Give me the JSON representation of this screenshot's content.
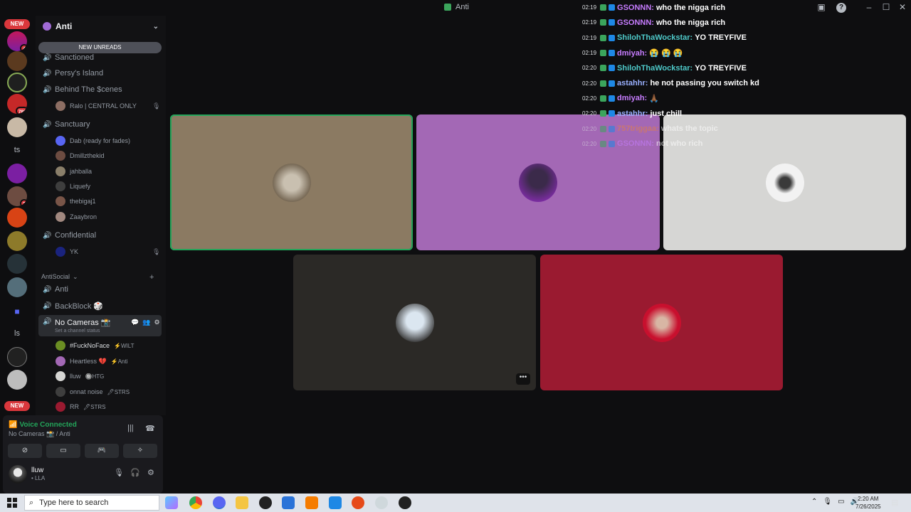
{
  "window": {
    "title": "Anti"
  },
  "rail": {
    "new_top": "NEW",
    "new_bottom": "NEW",
    "badge_1": "4",
    "badge_2": "786",
    "badge_3": "2",
    "text_ts": "ts",
    "text_ls": "ls"
  },
  "sidebar": {
    "server_name": "Anti",
    "new_unreads": "NEW UNREADS",
    "channels": [
      {
        "name": "Sanctioned"
      },
      {
        "name": "Persy's Island"
      },
      {
        "name": "Behind The $cenes"
      },
      {
        "name": "Sanctuary"
      },
      {
        "name": "Confidential"
      }
    ],
    "behind_member": "Ralo | CENTRAL ONLY",
    "sanctuary_members": [
      "Dab (ready for fades)",
      "Dmillzthekid",
      "jahballa",
      "Liquefy",
      "thebigaj1",
      "Zaaybron"
    ],
    "confidential_member": "YK",
    "category": "AntiSocial",
    "category_channels": [
      {
        "name": "Anti"
      },
      {
        "name": "BackBlock 🎲"
      }
    ],
    "active_channel": {
      "name": "No Cameras 📸",
      "status": "Set a channel status"
    },
    "voice_members": [
      {
        "name": "#FuckNoFace",
        "tag": "⚡WILT"
      },
      {
        "name": "Heartless 💔",
        "tag": "⚡Anti"
      },
      {
        "name": "lluw",
        "tag": "🔘HTG"
      },
      {
        "name": "onnat noise",
        "tag": "🖊STRS"
      },
      {
        "name": "RR",
        "tag": "🖊STRS"
      }
    ]
  },
  "voice_panel": {
    "status": "Voice Connected",
    "channel": "No Cameras 📸 / Anti",
    "user_name": "lluw",
    "user_tag": "• LLA"
  },
  "chat": [
    {
      "time": "02:19",
      "nick": "GSONNN:",
      "text": "who the nigga rich",
      "color": "#c77dff"
    },
    {
      "time": "02:19",
      "nick": "GSONNN:",
      "text": "who the nigga rich",
      "color": "#c77dff"
    },
    {
      "time": "02:19",
      "nick": "ShilohThaWockstar:",
      "text": "YO TREYFIVE",
      "color": "#4ec9c9"
    },
    {
      "time": "02:19",
      "nick": "dmiyah:",
      "text": "😭 😭 😭",
      "color": "#c77dff"
    },
    {
      "time": "02:20",
      "nick": "ShilohThaWockstar:",
      "text": "YO TREYFIVE",
      "color": "#4ec9c9"
    },
    {
      "time": "02:20",
      "nick": "astahhr:",
      "text": "he not passing you switch kd",
      "color": "#9ab0ff"
    },
    {
      "time": "02:20",
      "nick": "dmiyah:",
      "text": "🙏🏾",
      "color": "#c77dff"
    },
    {
      "time": "02:20",
      "nick": "astahhr:",
      "text": "just chill",
      "color": "#9ab0ff"
    },
    {
      "time": "02:20",
      "nick": "757triggaa:",
      "text": "whats the topic",
      "color": "#e8833a"
    },
    {
      "time": "02:20",
      "nick": "GSONNN:",
      "text": "not who rich",
      "color": "#c77dff"
    }
  ],
  "taskbar": {
    "search_placeholder": "Type here to search",
    "time": "2:20 AM",
    "date": "7/26/2025"
  },
  "colors": {
    "tile1": "#8b7a62",
    "tile2": "#a368b5",
    "tile3": "#d6d6d4",
    "tile4": "#2b2926",
    "tile5": "#9a1a30",
    "voice_green": "#23a55a"
  }
}
